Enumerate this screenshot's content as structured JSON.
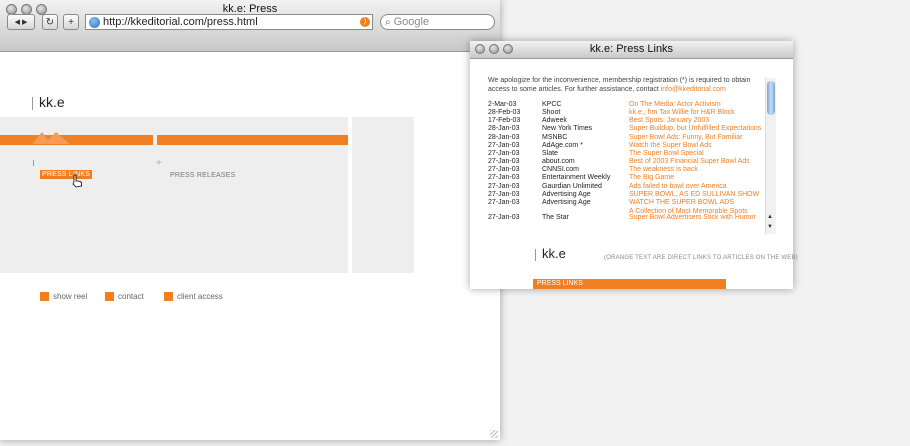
{
  "main_window": {
    "title": "kk.e: Press",
    "back_icon": "◀",
    "forward_icon": "▶",
    "reload_icon": "↻",
    "add_icon": "+",
    "url": "http://kkeditorial.com/press.html",
    "rss_icon": "rss-icon",
    "search_placeholder": "Google",
    "search_icon": "⌕"
  },
  "site": {
    "logo": "kk.e",
    "tabs": {
      "press_links": "PRESS LINKS",
      "press_releases": "PRESS RELEASES"
    },
    "footer_links": [
      "show reel",
      "contact",
      "client access"
    ]
  },
  "popup": {
    "title": "kk.e: Press Links",
    "intro": "We apologize for the inconvenience, membership registration (*) is required to obtain access to some articles. For further assistance, contact ",
    "contact_email": "info@kkeditorial.com",
    "rows": [
      {
        "date": "2-Mar-03",
        "publication": "KPCC",
        "title": "On The Media: Actor Activism"
      },
      {
        "date": "28-Feb-03",
        "publication": "Shoot",
        "title": "kk.e., hm Tax Willie for H&R Block"
      },
      {
        "date": "17-Feb-03",
        "publication": "Adweek",
        "title": "Best Spots: January 2003"
      },
      {
        "date": "28-Jan-03",
        "publication": "New York Times",
        "title": "Super Buildup, but Unfulfilled Expectations"
      },
      {
        "date": "28-Jan-03",
        "publication": "MSNBC",
        "title": "Super Bowl Ads: Funny, But Familiar"
      },
      {
        "date": "27-Jan-03",
        "publication": "AdAge.com *",
        "title": "Watch the Super Bowl Ads"
      },
      {
        "date": "27-Jan-03",
        "publication": "Slate",
        "title": "The Super Bowl Special"
      },
      {
        "date": "27-Jan-03",
        "publication": "about.com",
        "title": "Best of 2003 Financial Super Bowl Ads"
      },
      {
        "date": "27-Jan-03",
        "publication": "CNNSI.com",
        "title": "The weakness is back"
      },
      {
        "date": "27-Jan-03",
        "publication": "Entertainment Weekly",
        "title": "The Big Game"
      },
      {
        "date": "27-Jan-03",
        "publication": "Gaurdian Unlimited",
        "title": "Ads failed to bowl over America"
      },
      {
        "date": "27-Jan-03",
        "publication": "Advertising Age",
        "title": "SUPER BOWL, AS ED SULLIVAN SHOW"
      },
      {
        "date": "27-Jan-03",
        "publication": "Advertising Age",
        "title": "WATCH THE SUPER BOWL ADS",
        "title2": "A Collection of Most Memorable Spots"
      },
      {
        "date": "27-Jan-03",
        "publication": "The Star",
        "title": "Super Bowl Advertisers Stick with Humor"
      }
    ],
    "logo": "kk.e",
    "note": "(ORANGE TEXT ARE DIRECT LINKS TO ARTICLES ON THE WEB)",
    "tab_label": "PRESS LINKS"
  },
  "colors": {
    "accent": "#f07f23"
  }
}
